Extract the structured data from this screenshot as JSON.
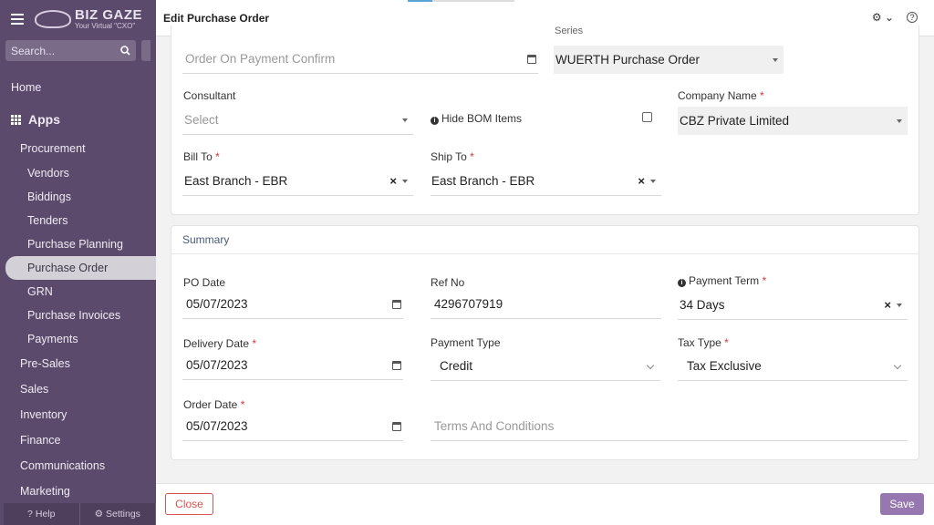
{
  "sidebar": {
    "brand_name": "BIZ GAZE",
    "brand_tagline": "Your Virtual \"CXO\"",
    "search_placeholder": "Search...",
    "home": "Home",
    "apps": "Apps",
    "procurement": "Procurement",
    "procurement_items": [
      "Vendors",
      "Biddings",
      "Tenders",
      "Purchase Planning",
      "Purchase Order",
      "GRN",
      "Purchase Invoices",
      "Payments"
    ],
    "sections": [
      "Pre-Sales",
      "Sales",
      "Inventory",
      "Finance",
      "Communications",
      "Marketing"
    ],
    "help": "Help",
    "settings": "Settings"
  },
  "header": {
    "title": "Edit Purchase Order"
  },
  "form": {
    "series_label_partial": "Series",
    "order_on_payment_placeholder": "Order On Payment Confirm",
    "series_value": "WUERTH Purchase Order",
    "consultant_label": "Consultant",
    "consultant_placeholder": "Select",
    "hide_bom_label": "Hide BOM Items",
    "company_label": "Company Name",
    "company_value": "CBZ Private Limited",
    "bill_to_label": "Bill To",
    "bill_to_value": "East Branch - EBR",
    "ship_to_label": "Ship To",
    "ship_to_value": "East Branch - EBR"
  },
  "summary": {
    "title": "Summary",
    "po_date_label": "PO Date",
    "po_date_value": "05/07/2023",
    "ref_no_label": "Ref No",
    "ref_no_value": "4296707919",
    "payment_term_label": "Payment Term",
    "payment_term_value": "34 Days",
    "delivery_date_label": "Delivery Date",
    "delivery_date_value": "05/07/2023",
    "payment_type_label": "Payment Type",
    "payment_type_value": "Credit",
    "tax_type_label": "Tax Type",
    "tax_type_value": "Tax Exclusive",
    "order_date_label": "Order Date",
    "order_date_value": "05/07/2023",
    "terms_placeholder": "Terms And Conditions"
  },
  "footer": {
    "close_label": "Close",
    "save_label": "Save"
  }
}
